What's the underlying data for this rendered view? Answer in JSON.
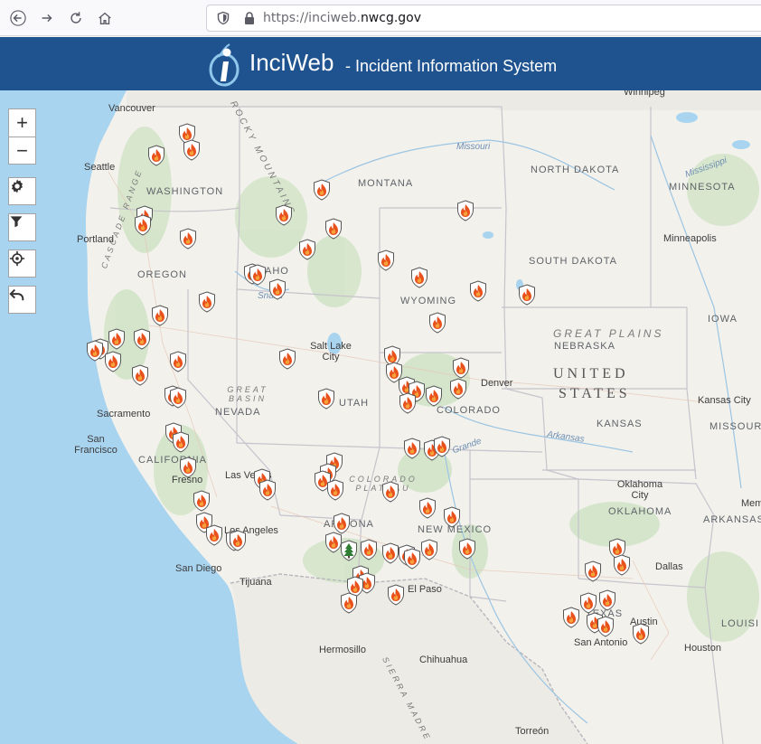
{
  "browser": {
    "url_prefix": "https://inciweb.",
    "url_domain": "nwcg.gov"
  },
  "header": {
    "brand": "InciWeb",
    "subtitle": "- Incident Information System"
  },
  "map": {
    "states": [
      "WASHINGTON",
      "OREGON",
      "IDAHO",
      "MONTANA",
      "WYOMING",
      "NORTH DAKOTA",
      "SOUTH DAKOTA",
      "MINNESOTA",
      "NEBRASKA",
      "IOWA",
      "NEVADA",
      "UTAH",
      "COLORADO",
      "KANSAS",
      "MISSOURI",
      "CALIFORNIA",
      "ARIZONA",
      "NEW MEXICO",
      "OKLAHOMA",
      "ARKANSAS",
      "TEXAS",
      "LOUISI"
    ],
    "cities": [
      "Vancouver",
      "Seattle",
      "Portland",
      "Salt Lake City",
      "Denver",
      "Sacramento",
      "San Francisco",
      "Fresno",
      "Las Vegas",
      "Los Angeles",
      "San Diego",
      "Tijuana",
      "Minneapolis",
      "Kansas City",
      "Oklahoma City",
      "Dallas",
      "Austin",
      "San Antonio",
      "Houston",
      "El Paso",
      "Hermosillo",
      "Chihuahua",
      "Torreón",
      "Winnipeg",
      "Mem"
    ],
    "regions": [
      "GREAT PLAINS",
      "GREAT BASIN",
      "COLORADO PLATEAU",
      "CASCADE RANGE",
      "ROCKY MOUNTAINS",
      "SIERRA MADRE"
    ],
    "country": [
      "UNITED",
      "STATES"
    ],
    "rivers": [
      "Missouri",
      "Mississippi",
      "Snake",
      "Arkansas",
      "Grande"
    ],
    "incident_icon": "fire-shield-icon",
    "special_icon": "tree-shield-icon"
  },
  "controls": {
    "zoom_in": "+",
    "zoom_out": "−"
  }
}
